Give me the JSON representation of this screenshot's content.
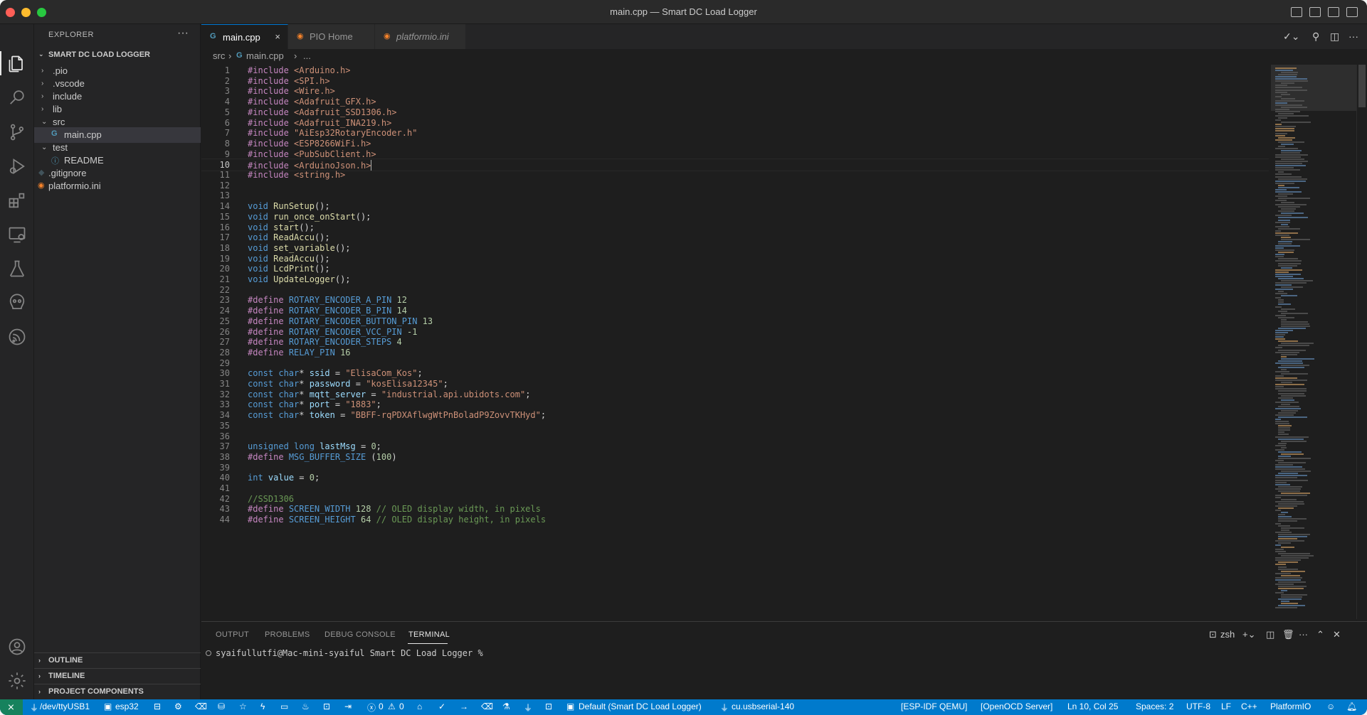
{
  "window": {
    "title": "main.cpp — Smart DC Load Logger"
  },
  "sidebar": {
    "header": "EXPLORER",
    "more": "···",
    "project": "SMART DC LOAD LOGGER",
    "tree": [
      {
        "label": ".pio",
        "chev": "›"
      },
      {
        "label": ".vscode",
        "chev": "›"
      },
      {
        "label": "include",
        "chev": "›"
      },
      {
        "label": "lib",
        "chev": "›"
      },
      {
        "label": "src",
        "chev": "⌄"
      },
      {
        "label": "main.cpp",
        "icon": "G"
      },
      {
        "label": "test",
        "chev": "⌄"
      },
      {
        "label": "README",
        "icon": "ⓘ"
      },
      {
        "label": ".gitignore",
        "icon": "◆"
      },
      {
        "label": "platformio.ini",
        "icon": "◉"
      }
    ],
    "sections": [
      "OUTLINE",
      "TIMELINE",
      "PROJECT COMPONENTS"
    ]
  },
  "tabs": [
    {
      "label": "main.cpp",
      "icon": "G",
      "close": "×"
    },
    {
      "label": "PIO Home",
      "icon": "◉"
    },
    {
      "label": "platformio.ini",
      "icon": "◉"
    }
  ],
  "breadcrumb": {
    "folder": "src",
    "sep": "›",
    "file": "main.cpp",
    "tail": "..."
  },
  "code_lines": [
    "#include <Arduino.h>",
    "#include <SPI.h>",
    "#include <Wire.h>",
    "#include <Adafruit_GFX.h>",
    "#include <Adafruit_SSD1306.h>",
    "#include <Adafruit_INA219.h>",
    "#include \"AiEsp32RotaryEncoder.h\"",
    "#include <ESP8266WiFi.h>",
    "#include <PubSubClient.h>",
    "#include <ArduinoJson.h>",
    "#include <string.h>",
    "",
    "",
    "void RunSetup();",
    "void run_once_onStart();",
    "void start();",
    "void ReadAccu();",
    "void set_variable();",
    "void ReadAccu();",
    "void LcdPrint();",
    "void UpdateLogger();",
    "",
    "#define ROTARY_ENCODER_A_PIN 12",
    "#define ROTARY_ENCODER_B_PIN 14",
    "#define ROTARY_ENCODER_BUTTON_PIN 13",
    "#define ROTARY_ENCODER_VCC_PIN -1",
    "#define ROTARY_ENCODER_STEPS 4",
    "#define RELAY_PIN 16",
    "",
    "const char* ssid = \"ElisaCom_Kos\";",
    "const char* password = \"kosElisa12345\";",
    "const char* mqtt_server = \"industrial.api.ubidots.com\";",
    "const char* port = \"1883\";",
    "const char* token = \"BBFF-rqPDXAflwgWtPnBoladP9ZovvTKHyd\";",
    "",
    "",
    "unsigned long lastMsg = 0;",
    "#define MSG_BUFFER_SIZE (100)",
    "",
    "int value = 0;",
    "",
    "//SSD1306",
    "#define SCREEN_WIDTH 128 // OLED display width, in pixels",
    "#define SCREEN_HEIGHT 64 // OLED display height, in pixels"
  ],
  "cursor_line": 10,
  "panel": {
    "tabs": [
      "OUTPUT",
      "PROBLEMS",
      "DEBUG CONSOLE",
      "TERMINAL"
    ],
    "active_tab": "TERMINAL",
    "shell": "zsh",
    "terminal_prompt": "syaifullutfi@Mac-mini-syaiful Smart DC Load Logger %"
  },
  "statusbar": {
    "port": "/dev/ttyUSB1",
    "env": "esp32",
    "errors": "0",
    "warnings": "0",
    "project_env": "Default (Smart DC Load Logger)",
    "serial": "cu.usbserial-140",
    "idf": "[ESP-IDF QEMU]",
    "openocd": "[OpenOCD Server]",
    "position": "Ln 10, Col 25",
    "spaces": "Spaces: 2",
    "encoding": "UTF-8",
    "eol": "LF",
    "language": "C++",
    "platformio": "PlatformIO"
  },
  "colors": {
    "statusbar": "#007acc",
    "accent": "#0078d4",
    "editor_bg": "#1e1e1e",
    "sidebar_bg": "#252526"
  }
}
